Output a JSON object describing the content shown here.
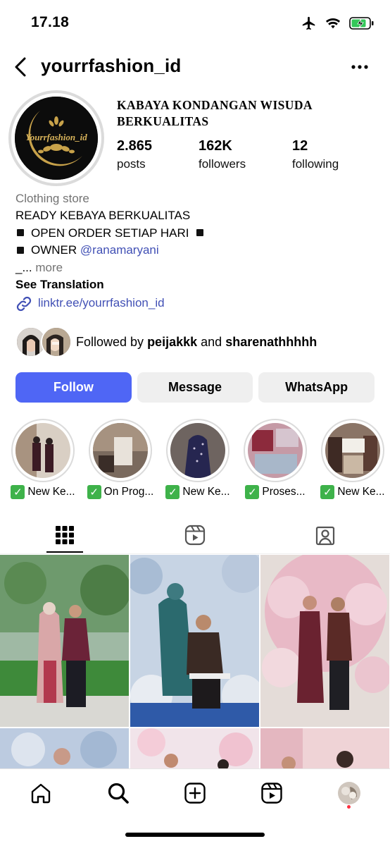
{
  "status_bar": {
    "time": "17.18"
  },
  "header": {
    "username": "yourrfashion_id"
  },
  "profile": {
    "name_line1": "KABAYA KONDANGAN WISUDA",
    "name_line2": "BERKUALITAS",
    "avatar_text": "Yourrfashion_id",
    "stats": [
      {
        "value": "2.865",
        "label": "posts"
      },
      {
        "value": "162K",
        "label": "followers"
      },
      {
        "value": "12",
        "label": "following"
      }
    ]
  },
  "bio": {
    "category": "Clothing store",
    "line1": "READY KEBAYA BERKUALITAS",
    "line2": "OPEN ORDER SETIAP HARI",
    "line3_prefix": "OWNER",
    "line3_mention": "@ranamaryani",
    "line4_prefix": "_...",
    "more": "more",
    "see_translation": "See Translation",
    "link": "linktr.ee/yourrfashion_id"
  },
  "followed_by": {
    "prefix": "Followed by",
    "user1": "peijakkk",
    "joiner": "and",
    "user2": "sharenathhhhh"
  },
  "actions": {
    "follow": "Follow",
    "message": "Message",
    "whatsapp": "WhatsApp"
  },
  "highlights": [
    {
      "label": "New Ke..."
    },
    {
      "label": "On Prog..."
    },
    {
      "label": "New Ke..."
    },
    {
      "label": "Proses..."
    },
    {
      "label": "New Ke..."
    }
  ],
  "tabs": [
    "posts-grid",
    "reels",
    "tagged"
  ],
  "colors": {
    "accent": "#4f66f5",
    "link": "#4150b5",
    "secondary_text": "#737373",
    "button_grey": "#efefef",
    "notification": "#ff3040"
  }
}
